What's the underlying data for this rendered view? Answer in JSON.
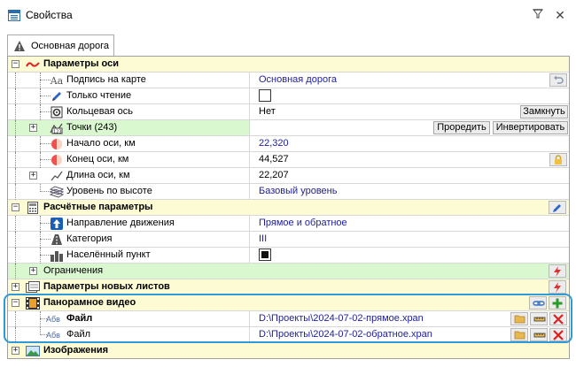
{
  "window": {
    "title": "Свойства",
    "pin_icon": "filter-pin-icon",
    "close_icon": "close-icon"
  },
  "tab": {
    "label": "Основная дорога",
    "icon": "road-warning-icon"
  },
  "sections": {
    "axis": {
      "title": "Параметры оси",
      "rows": {
        "map_label": {
          "name": "Подпись на карте",
          "value": "Основная дорога"
        },
        "read_only": {
          "name": "Только чтение",
          "checked": false
        },
        "ring_axis": {
          "name": "Кольцевая ось",
          "value": "Нет",
          "button": "Замкнуть"
        },
        "points": {
          "name": "Точки (243)",
          "button_draw": "Проредить",
          "button_invert": "Инвертировать"
        },
        "start": {
          "name": "Начало оси, км",
          "value": "22,320"
        },
        "end": {
          "name": "Конец оси, км",
          "value": "44,527"
        },
        "length": {
          "name": "Длина оси, км",
          "value": "22,207"
        },
        "level": {
          "name": "Уровень по высоте",
          "value": "Базовый уровень"
        }
      }
    },
    "calc": {
      "title": "Расчётные параметры",
      "rows": {
        "direction": {
          "name": "Направление движения",
          "value": "Прямое и обратное"
        },
        "category": {
          "name": "Категория",
          "value": "III"
        },
        "settlement": {
          "name": "Населённый пункт",
          "checked": true
        },
        "restrictions": {
          "name": "Ограничения"
        }
      }
    },
    "sheets": {
      "title": "Параметры новых листов"
    },
    "video": {
      "title": "Панорамное видео",
      "files": [
        {
          "name": "Файл",
          "value": "D:\\Проекты\\2024-07-02-прямое.xpan"
        },
        {
          "name": "Файл",
          "value": "D:\\Проекты\\2024-07-02-обратное.xpan"
        }
      ]
    },
    "images": {
      "title": "Изображения"
    }
  },
  "colors": {
    "category_bg": "#fdfbd3",
    "group_bg": "#d9f8cf",
    "highlight": "#2f9ad8",
    "value_blue": "#2020a0"
  }
}
